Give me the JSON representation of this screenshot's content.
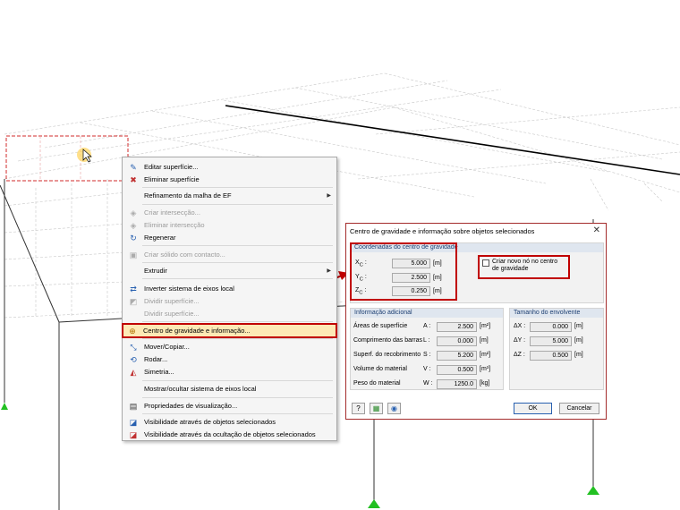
{
  "context_menu": {
    "items": [
      {
        "label": "Editar superfície...",
        "icon": "edit-surface-icon",
        "enabled": true
      },
      {
        "label": "Eliminar superfície",
        "icon": "delete-surface-icon",
        "enabled": true
      },
      {
        "label": "Refinamento da malha de EF",
        "icon": "",
        "enabled": true,
        "submenu": true
      },
      {
        "label": "Criar intersecção...",
        "icon": "create-intersection-icon",
        "enabled": false
      },
      {
        "label": "Eliminar intersecção",
        "icon": "delete-intersection-icon",
        "enabled": false
      },
      {
        "label": "Regenerar",
        "icon": "regenerate-icon",
        "enabled": true
      },
      {
        "label": "Criar sólido com contacto...",
        "icon": "create-solid-icon",
        "enabled": false
      },
      {
        "label": "Extrudir",
        "icon": "",
        "enabled": true,
        "submenu": true
      },
      {
        "label": "Inverter sistema de eixos local",
        "icon": "invert-axes-icon",
        "enabled": true
      },
      {
        "label": "Dividir superfície...",
        "icon": "divide-surface-icon",
        "enabled": false
      },
      {
        "label": "Dividir superfície...",
        "icon": "",
        "enabled": false
      },
      {
        "label": "Centro de gravidade e informação...",
        "icon": "center-of-gravity-icon",
        "enabled": true,
        "highlighted": true
      },
      {
        "label": "Mover/Copiar...",
        "icon": "move-copy-icon",
        "enabled": true
      },
      {
        "label": "Rodar...",
        "icon": "rotate-icon",
        "enabled": true
      },
      {
        "label": "Simetria...",
        "icon": "mirror-icon",
        "enabled": true
      },
      {
        "label": "Mostrar/ocultar sistema de eixos local",
        "icon": "",
        "enabled": true
      },
      {
        "label": "Propriedades de visualização...",
        "icon": "display-properties-icon",
        "enabled": true
      },
      {
        "label": "Visibilidade através de objetos selecionados",
        "icon": "visibility-selected-icon",
        "enabled": true
      },
      {
        "label": "Visibilidade através da ocultação de objetos selecionados",
        "icon": "visibility-hide-icon",
        "enabled": true
      }
    ]
  },
  "dialog": {
    "title": "Centro de gravidade e informação sobre objetos selecionados",
    "close_glyph": "✕",
    "coords": {
      "header": "Coordenadas do centro de gravidade",
      "rows": [
        {
          "sym": "X",
          "sub": "C",
          "value": "5.000",
          "unit": "[m]"
        },
        {
          "sym": "Y",
          "sub": "C",
          "value": "2.500",
          "unit": "[m]"
        },
        {
          "sym": "Z",
          "sub": "C",
          "value": "0.250",
          "unit": "[m]"
        }
      ]
    },
    "create_node_label": "Criar novo nó no centro de gravidade",
    "info": {
      "header": "Informação adicional",
      "rows": [
        {
          "label": "Áreas de superfície",
          "sym": "A",
          "value": "2.500",
          "unit": "[m²]"
        },
        {
          "label": "Comprimento das barras",
          "sym": "L",
          "value": "0.000",
          "unit": "[m]"
        },
        {
          "label": "Superf. do recobrimento",
          "sym": "S",
          "value": "5.200",
          "unit": "[m²]"
        },
        {
          "label": "Volume do material",
          "sym": "V",
          "value": "0.500",
          "unit": "[m³]"
        },
        {
          "label": "Peso do material",
          "sym": "W",
          "value": "1250.0",
          "unit": "[kg]"
        }
      ]
    },
    "envelope": {
      "header": "Tamanho do envolvente",
      "rows": [
        {
          "sym": "ΔX",
          "value": "0.000",
          "unit": "[m]"
        },
        {
          "sym": "ΔY",
          "value": "5.000",
          "unit": "[m]"
        },
        {
          "sym": "ΔZ",
          "value": "0.500",
          "unit": "[m]"
        }
      ]
    },
    "ok_label": "OK",
    "cancel_label": "Cancelar"
  },
  "colors": {
    "highlight_red": "#c00000",
    "support_green": "#22c022",
    "group_header": "#dfe6ef"
  }
}
